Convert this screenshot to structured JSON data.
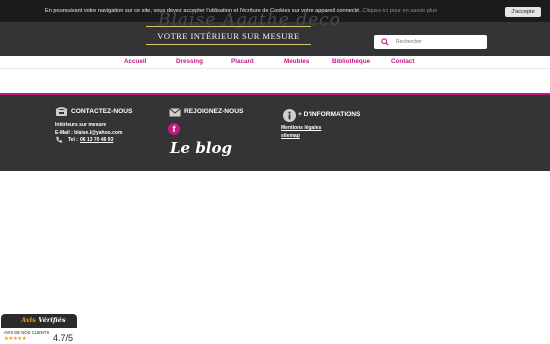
{
  "cookie": {
    "text": "En poursuivant votre navigation sur ce site, vous devez accepter l'utilisation et l'écriture de Cookies sur votre appareil connecté.",
    "link": "Cliquez-ici pour en savoir plus",
    "accept": "J'accepte"
  },
  "header": {
    "logo": "Blaise Agathe deco",
    "tagline": "VOTRE INTÉRIEUR SUR MESURE",
    "search_placeholder": "Rechercher"
  },
  "nav": {
    "items": [
      "Accueil",
      "Dressing",
      "Placard",
      "Meubles",
      "Bibliothèque",
      "Contact"
    ]
  },
  "footer": {
    "contact": {
      "title": "CONTACTEZ-NOUS",
      "line1": "Intérieurs sur mesure",
      "email": "E-Mail : blaise.l@yahoo.com",
      "tel_label": "Tel :",
      "tel": "06 13 70 46 93"
    },
    "join": {
      "title": "REJOIGNEZ-NOUS",
      "fb": "f",
      "blog": "Le blog"
    },
    "info": {
      "title": "+ D'INFORMATIONS",
      "links": [
        "Mentions légales",
        "sitemap"
      ]
    }
  },
  "badge": {
    "title_avis": "Avis",
    "title_rest": "Vérifiés",
    "subtitle": "AVIS DE NOS CLIENTS",
    "stars": "★★★★★",
    "score": "4.7/5",
    "star_color": "#f29a1f"
  },
  "colors": {
    "accent": "#c01c80",
    "dark": "#343436",
    "gold": "#d6c86a"
  }
}
